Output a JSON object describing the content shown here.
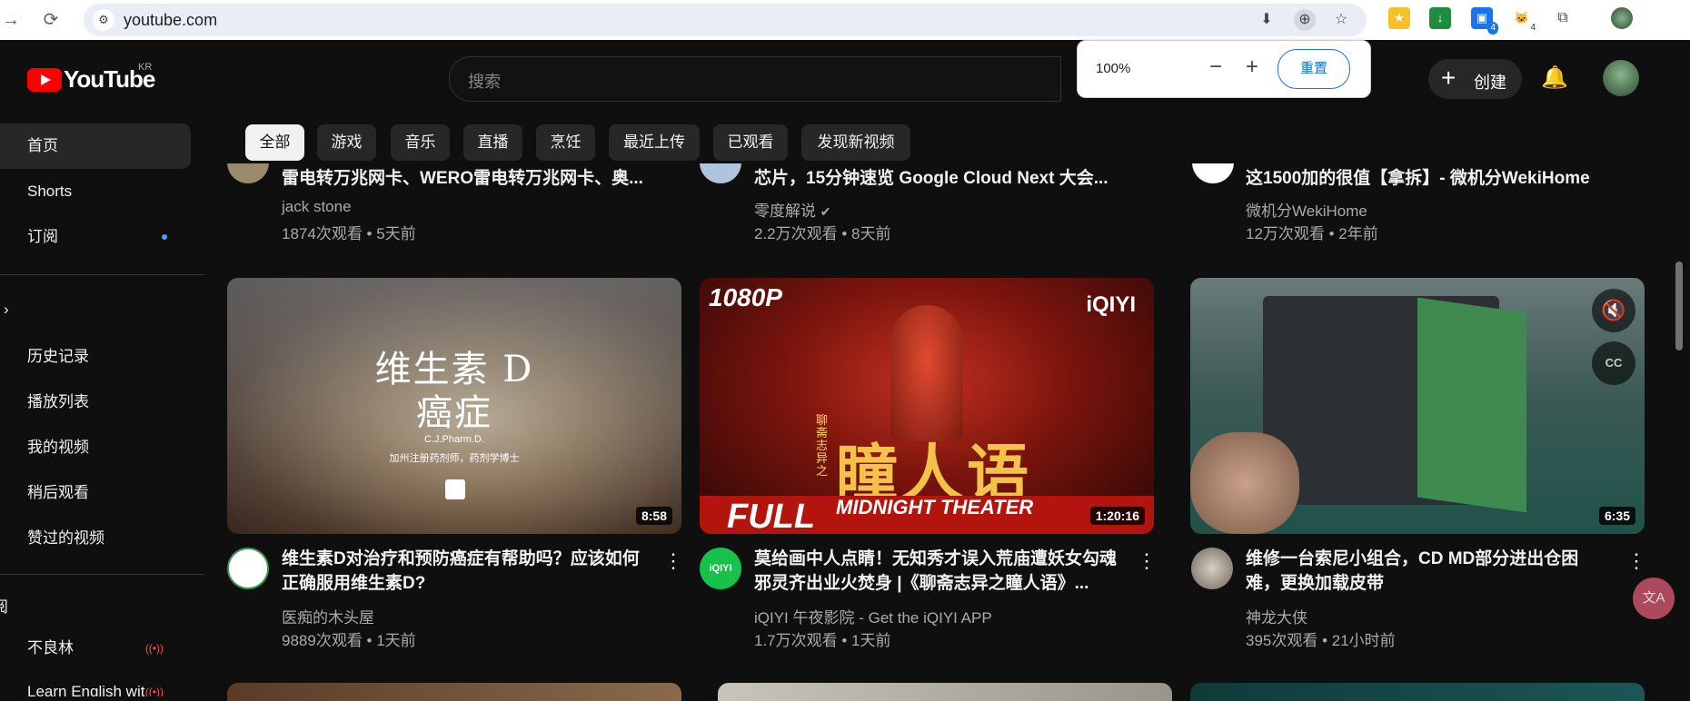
{
  "browser": {
    "url": "youtube.com",
    "zoom_percent": "100%",
    "zoom_minus": "−",
    "zoom_plus": "+",
    "zoom_reset": "重置",
    "ext_badge_1": "4",
    "ext_badge_2": "4"
  },
  "header": {
    "logo_text": "YouTube",
    "region": "KR",
    "search_placeholder": "搜索",
    "create_label": "创建"
  },
  "sidebar": {
    "items": [
      {
        "label": "首页"
      },
      {
        "label": "Shorts"
      },
      {
        "label": "订阅"
      },
      {
        "label": "历史记录"
      },
      {
        "label": "播放列表"
      },
      {
        "label": "我的视频"
      },
      {
        "label": "稍后观看"
      },
      {
        "label": "赞过的视频"
      }
    ],
    "section_fragment": "阅",
    "subscriptions": [
      {
        "label": "不良林"
      },
      {
        "label": "Learn English wit"
      }
    ],
    "live_icon": "((•))"
  },
  "chips": [
    "全部",
    "游戏",
    "音乐",
    "直播",
    "烹饪",
    "最近上传",
    "已观看",
    "发现新视频"
  ],
  "row1": [
    {
      "title": "雷电转万兆网卡、WERO雷电转万兆网卡、奥...",
      "channel": "jack stone",
      "stats": "1874次观看 • 5天前"
    },
    {
      "title": "芯片，15分钟速览 Google Cloud Next 大会...",
      "channel": "零度解说",
      "stats": "2.2万次观看 • 8天前"
    },
    {
      "title": "这1500加的很值【拿拆】- 微机分WekiHome",
      "channel": "微机分WekiHome",
      "stats": "12万次观看 • 2年前"
    }
  ],
  "row2": [
    {
      "thumb_line1": "维生素 D",
      "thumb_line2": "癌症",
      "thumb_line3": "C.J.Pharm.D.",
      "thumb_line4": "加州注册药剂师，药剂学博士",
      "duration": "8:58",
      "title": "维生素D对治疗和预防癌症有帮助吗？应该如何正确服用维生素D?",
      "channel": "医痴的木头屋",
      "stats": "9889次观看 • 1天前"
    },
    {
      "thumb_badge": "1080P",
      "thumb_brand": "iQIYI",
      "thumb_vertical": "聊斋志异之",
      "thumb_title": "瞳人语",
      "thumb_full": "FULL",
      "thumb_theater": "MIDNIGHT THEATER",
      "duration": "1:20:16",
      "avatar_text": "iQIYI",
      "title": "莫给画中人点睛！无知秀才误入荒庙遭妖女勾魂 邪灵齐出业火焚身 |《聊斋志异之瞳人语》...",
      "channel": "iQIYI 午夜影院 - Get the iQIYI APP",
      "stats": "1.7万次观看 • 1天前"
    },
    {
      "duration": "6:35",
      "title": "维修一台索尼小组合，CD MD部分进出仓困难，更换加载皮带",
      "channel": "神龙大侠",
      "stats": "395次观看 • 21小时前"
    }
  ],
  "colors": {
    "brand": "#ff0000",
    "bg": "#0f0f0f",
    "accent": "#3ea6ff"
  }
}
